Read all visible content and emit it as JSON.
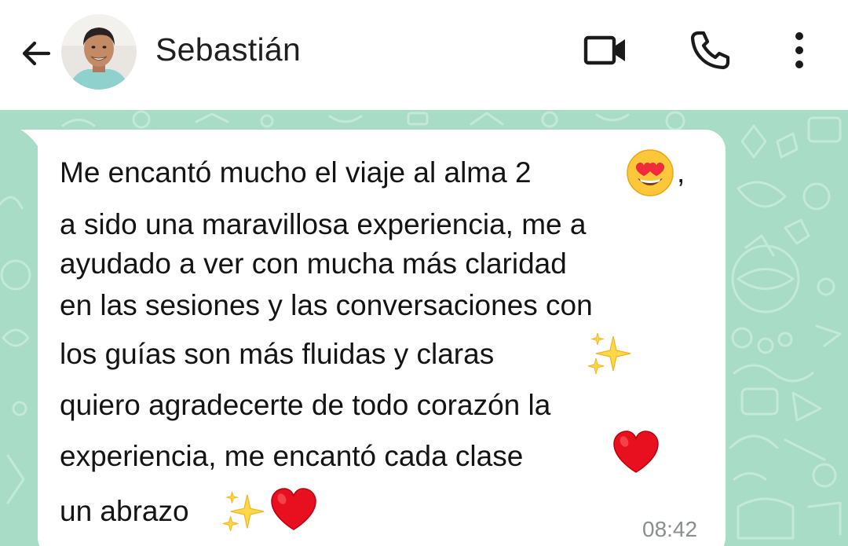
{
  "header": {
    "back_icon": "arrow-left-icon",
    "contact_name": "Sebastián",
    "avatar_icon": "contact-avatar",
    "video_icon": "video-camera-icon",
    "call_icon": "phone-icon",
    "menu_icon": "more-vert-icon"
  },
  "message": {
    "line_1": "Me encantó mucho el viaje al alma 2",
    "line_1_after": ",",
    "line_2": "a sido una maravillosa experiencia, me a",
    "line_3": "ayudado a ver con mucha más claridad",
    "line_4": "en las sesiones y las conversaciones con",
    "line_5": "los guías son más fluidas y claras",
    "line_6": "quiero agradecerte de todo corazón la",
    "line_7": "experiencia, me encantó cada clase",
    "line_8": "un abrazo",
    "timestamp": "08:42",
    "emojis": [
      "heart-eyes-emoji",
      "sparkles-emoji",
      "red-heart-emoji",
      "sparkles-emoji",
      "red-heart-emoji"
    ]
  },
  "colors": {
    "header_bg": "#ffffff",
    "wallpaper": "#a8dcc6",
    "bubble": "#ffffff",
    "text": "#141414",
    "timestamp": "#8a8f8c"
  }
}
